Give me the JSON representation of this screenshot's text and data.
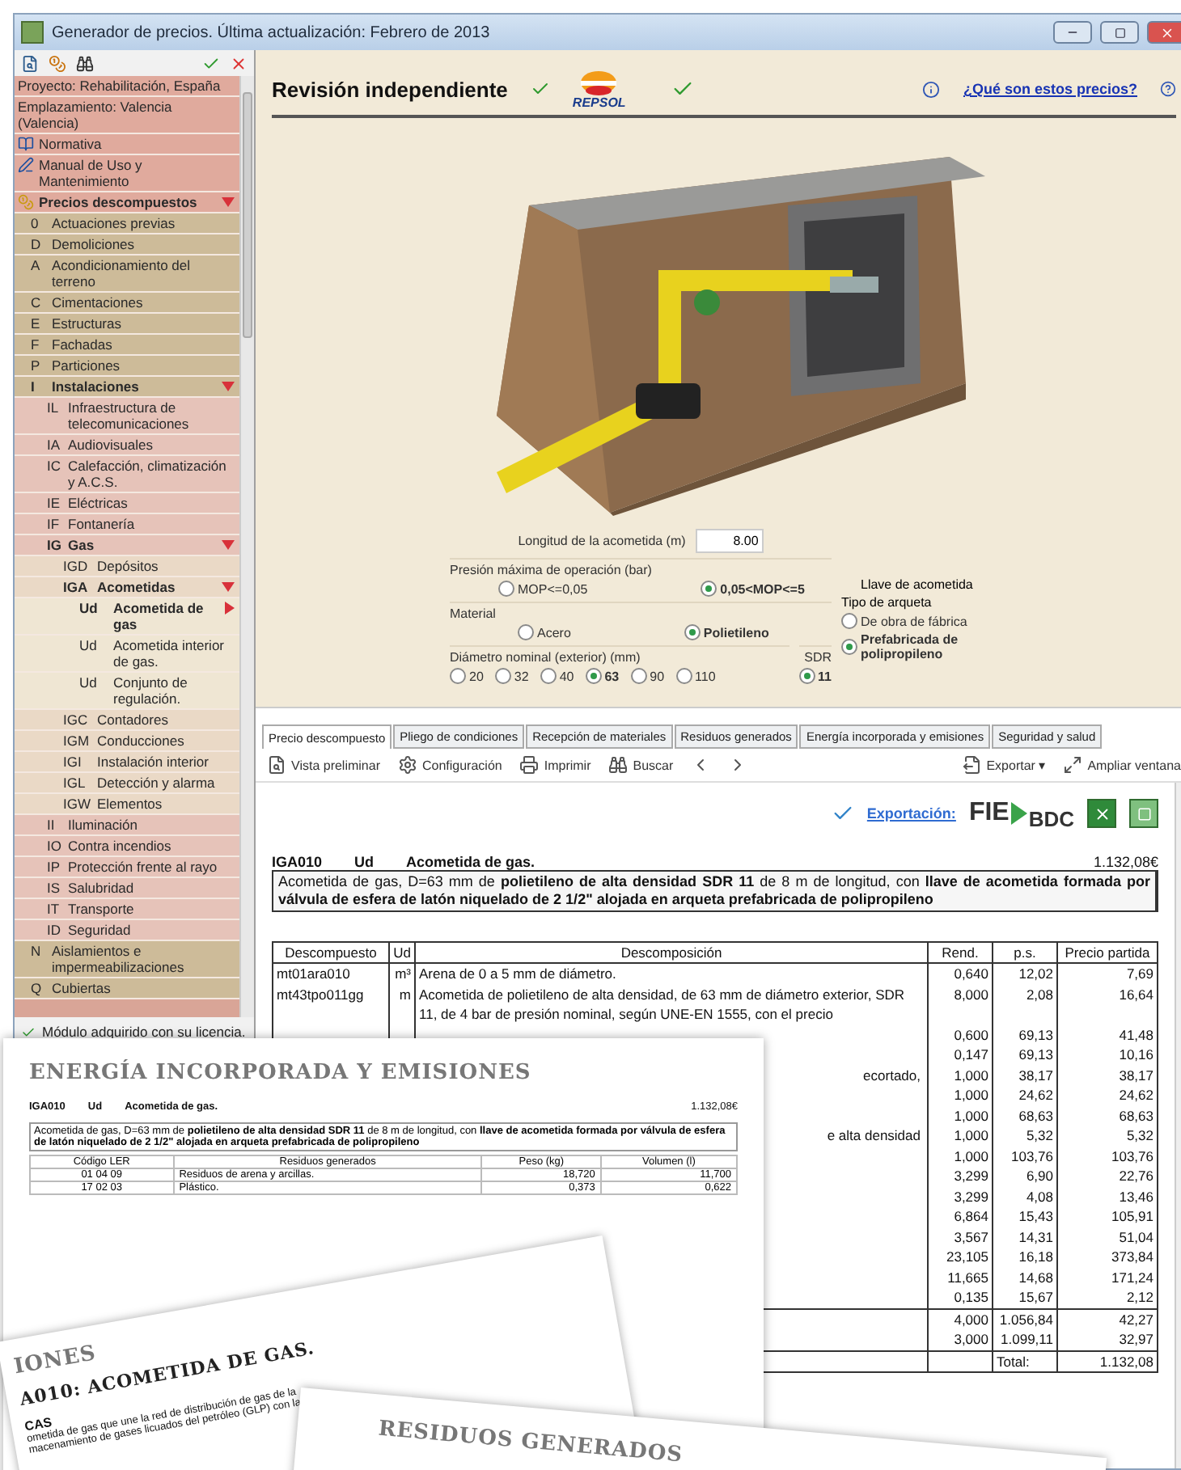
{
  "window": {
    "title": "Generador de precios. Última actualización: Febrero de 2013"
  },
  "sidebar": {
    "items": [
      {
        "label": "Proyecto: Rehabilitación, España",
        "kind": "plain"
      },
      {
        "label": "Emplazamiento: Valencia (Valencia)",
        "kind": "plain"
      },
      {
        "label": "Normativa",
        "kind": "book"
      },
      {
        "label": "Manual de Uso y Mantenimiento",
        "kind": "manual"
      },
      {
        "label": "Precios descompuestos",
        "kind": "prices",
        "expanded": true,
        "children": [
          {
            "code": "0",
            "label": "Actuaciones previas"
          },
          {
            "code": "D",
            "label": "Demoliciones"
          },
          {
            "code": "A",
            "label": "Acondicionamiento del terreno"
          },
          {
            "code": "C",
            "label": "Cimentaciones"
          },
          {
            "code": "E",
            "label": "Estructuras"
          },
          {
            "code": "F",
            "label": "Fachadas"
          },
          {
            "code": "P",
            "label": "Particiones"
          },
          {
            "code": "I",
            "label": "Instalaciones",
            "expanded": true,
            "children": [
              {
                "code": "IL",
                "label": "Infraestructura de telecomunicaciones"
              },
              {
                "code": "IA",
                "label": "Audiovisuales"
              },
              {
                "code": "IC",
                "label": "Calefacción, climatización y A.C.S."
              },
              {
                "code": "IE",
                "label": "Eléctricas"
              },
              {
                "code": "IF",
                "label": "Fontanería"
              },
              {
                "code": "IG",
                "label": "Gas",
                "expanded": true,
                "children": [
                  {
                    "code": "IGD",
                    "label": "Depósitos"
                  },
                  {
                    "code": "IGA",
                    "label": "Acometidas",
                    "expanded": true,
                    "children": [
                      {
                        "code": "Ud",
                        "label": "Acometida de gas",
                        "selected": true
                      },
                      {
                        "code": "Ud",
                        "label": "Acometida interior de gas.",
                        "selected": false
                      },
                      {
                        "code": "Ud",
                        "label": "Conjunto de regulación.",
                        "selected": false
                      }
                    ]
                  },
                  {
                    "code": "IGC",
                    "label": "Contadores"
                  },
                  {
                    "code": "IGM",
                    "label": "Conducciones"
                  },
                  {
                    "code": "IGI",
                    "label": "Instalación interior"
                  },
                  {
                    "code": "IGL",
                    "label": "Detección y alarma"
                  },
                  {
                    "code": "IGW",
                    "label": "Elementos"
                  }
                ]
              },
              {
                "code": "II",
                "label": "Iluminación"
              },
              {
                "code": "IO",
                "label": "Contra incendios"
              },
              {
                "code": "IP",
                "label": "Protección frente al rayo"
              },
              {
                "code": "IS",
                "label": "Salubridad"
              },
              {
                "code": "IT",
                "label": "Transporte"
              },
              {
                "code": "ID",
                "label": "Seguridad"
              }
            ]
          },
          {
            "code": "N",
            "label": "Aislamientos e impermeabilizaciones"
          },
          {
            "code": "Q",
            "label": "Cubiertas"
          }
        ]
      }
    ],
    "footer": "Módulo adquirido con su licencia."
  },
  "header": {
    "title": "Revisión independiente",
    "logo": "REPSOL",
    "help_link": "¿Qué son estos precios?"
  },
  "form": {
    "length": {
      "label": "Longitud de la acometida (m)",
      "value": "8.00"
    },
    "groups": [
      {
        "label": "Presión máxima de operación (bar)",
        "options": [
          {
            "label": "MOP<=0,05",
            "selected": false
          },
          {
            "label": "0,05<MOP<=5",
            "selected": true
          }
        ]
      },
      {
        "label": "Material",
        "options": [
          {
            "label": "Acero",
            "selected": false
          },
          {
            "label": "Polietileno",
            "selected": true
          }
        ]
      },
      {
        "label": "Diámetro nominal (exterior) (mm)",
        "options": [
          {
            "label": "20",
            "selected": false
          },
          {
            "label": "32",
            "selected": false
          },
          {
            "label": "40",
            "selected": false
          },
          {
            "label": "63",
            "selected": true
          },
          {
            "label": "90",
            "selected": false
          },
          {
            "label": "110",
            "selected": false
          }
        ]
      }
    ],
    "sdr": {
      "label": "SDR",
      "options": [
        {
          "label": "11",
          "selected": true
        }
      ]
    },
    "valve_label": "Llave de acometida",
    "arqueta": {
      "label": "Tipo de arqueta",
      "options": [
        {
          "label": "De obra de fábrica",
          "selected": false
        },
        {
          "label": "Prefabricada de polipropileno",
          "selected": true
        }
      ]
    }
  },
  "tabs": [
    {
      "label": "Precio descompuesto",
      "selected": true
    },
    {
      "label": "Pliego de condiciones",
      "selected": false
    },
    {
      "label": "Recepción de materiales",
      "selected": false
    },
    {
      "label": "Residuos generados",
      "selected": false
    },
    {
      "label": "Energía incorporada y emisiones",
      "selected": false
    },
    {
      "label": "Seguridad y salud",
      "selected": false
    }
  ],
  "toolbar": [
    {
      "label": "Vista preliminar",
      "kind": "preview"
    },
    {
      "label": "Configuración",
      "kind": "config"
    },
    {
      "label": "Imprimir",
      "kind": "print"
    },
    {
      "label": "Buscar",
      "kind": "search"
    },
    {
      "kind": "prev"
    },
    {
      "kind": "next"
    }
  ],
  "toolbar_right": [
    {
      "label": "Exportar ▾",
      "kind": "export"
    },
    {
      "label": "Ampliar ventana",
      "kind": "expand"
    }
  ],
  "export": {
    "label": "Exportación:",
    "logo_left": "FIE",
    "logo_right": "BDC"
  },
  "price": {
    "code": "IGA010",
    "unit": "Ud",
    "title": "Acometida de gas.",
    "amount": "1.132,08€",
    "description": "Acometida de gas, D=63 mm de **polietileno de alta densidad SDR 11** de 8 m de longitud, con **llave de acometida formada por válvula de esfera de latón niquelado de 2 1/2\" alojada en arqueta prefabricada de polipropileno**"
  },
  "table": {
    "columns": [
      "Descompuesto",
      "Ud",
      "Descomposición",
      "Rend.",
      "p.s.",
      "Precio partida"
    ],
    "rows": [
      {
        "code": "mt01ara010",
        "unit": "m³",
        "description": "Arena de 0 a 5 mm de diámetro.",
        "rend": "0,640",
        "ps": "12,02",
        "price": "7,69"
      },
      {
        "code": "mt43tpo011gg",
        "unit": "m",
        "description": "Acometida de polietileno de alta densidad, de 63 mm de diámetro exterior, SDR 11, de 4 bar de presión nominal, según UNE-EN 1555, con el precio",
        "rend": "8,000",
        "ps": "2,08",
        "price": "16,64"
      },
      {
        "rend": "0,600",
        "ps": "69,13",
        "price": "41,48"
      },
      {
        "rend": "0,147",
        "ps": "69,13",
        "price": "10,16"
      },
      {
        "description": "ecortado,",
        "rend": "1,000",
        "ps": "38,17",
        "price": "38,17"
      },
      {
        "rend": "1,000",
        "ps": "24,62",
        "price": "24,62"
      },
      {
        "rend": "1,000",
        "ps": "68,63",
        "price": "68,63"
      },
      {
        "description": "e alta densidad",
        "rend": "1,000",
        "ps": "5,32",
        "price": "5,32"
      },
      {
        "rend": "1,000",
        "ps": "103,76",
        "price": "103,76"
      },
      {
        "rend": "3,299",
        "ps": "6,90",
        "price": "22,76"
      },
      {
        "rend": "3,299",
        "ps": "4,08",
        "price": "13,46"
      },
      {
        "rend": "6,864",
        "ps": "15,43",
        "price": "105,91"
      },
      {
        "rend": "3,567",
        "ps": "14,31",
        "price": "51,04"
      },
      {
        "rend": "23,105",
        "ps": "16,18",
        "price": "373,84"
      },
      {
        "rend": "11,665",
        "ps": "14,68",
        "price": "171,24"
      },
      {
        "rend": "0,135",
        "ps": "15,67",
        "price": "2,12"
      }
    ],
    "subtotals": [
      {
        "rend": "4,000",
        "ps": "1.056,84",
        "price": "42,27"
      },
      {
        "rend": "3,000",
        "ps": "1.099,11",
        "price": "32,97"
      }
    ],
    "total": {
      "label": "Total:",
      "value": "1.132,08"
    }
  },
  "sheets": [
    {
      "kind": "energy",
      "title": "ENERGÍA INCORPORADA Y EMISIONES",
      "code": "IGA010",
      "unit": "Ud",
      "name": "Acometida de gas.",
      "amount": "1.132,08€",
      "description": "Acometida de gas, D=63 mm de **polietileno de alta densidad SDR 11** de 8 m de longitud, con **llave de acometida formada por válvula de esfera de latón niquelado de 2 1/2\" alojada en arqueta prefabricada de polipropileno**",
      "columns": [
        "Código LER",
        "Residuos generados",
        "Peso (kg)",
        "Volumen (l)"
      ],
      "rows": [
        {
          "code": "01 04 09",
          "name": "Residuos de arena y arcillas.",
          "weight": "18,720",
          "volume": "11,700"
        },
        {
          "code": "17 02 03",
          "name": "Plástico.",
          "weight": "0,373",
          "volume": "0,622"
        }
      ]
    },
    {
      "kind": "conditions",
      "title": "IONES",
      "subtitle": "A010: ACOMETIDA DE GAS.",
      "section": "CAS",
      "lines": [
        "ometida de gas que une la red de distribución de gas de la",
        "macenamiento de gases licuados del petróleo (GLP) con la"
      ]
    },
    {
      "kind": "waste",
      "title": "RESIDUOS GENERADOS"
    }
  ]
}
